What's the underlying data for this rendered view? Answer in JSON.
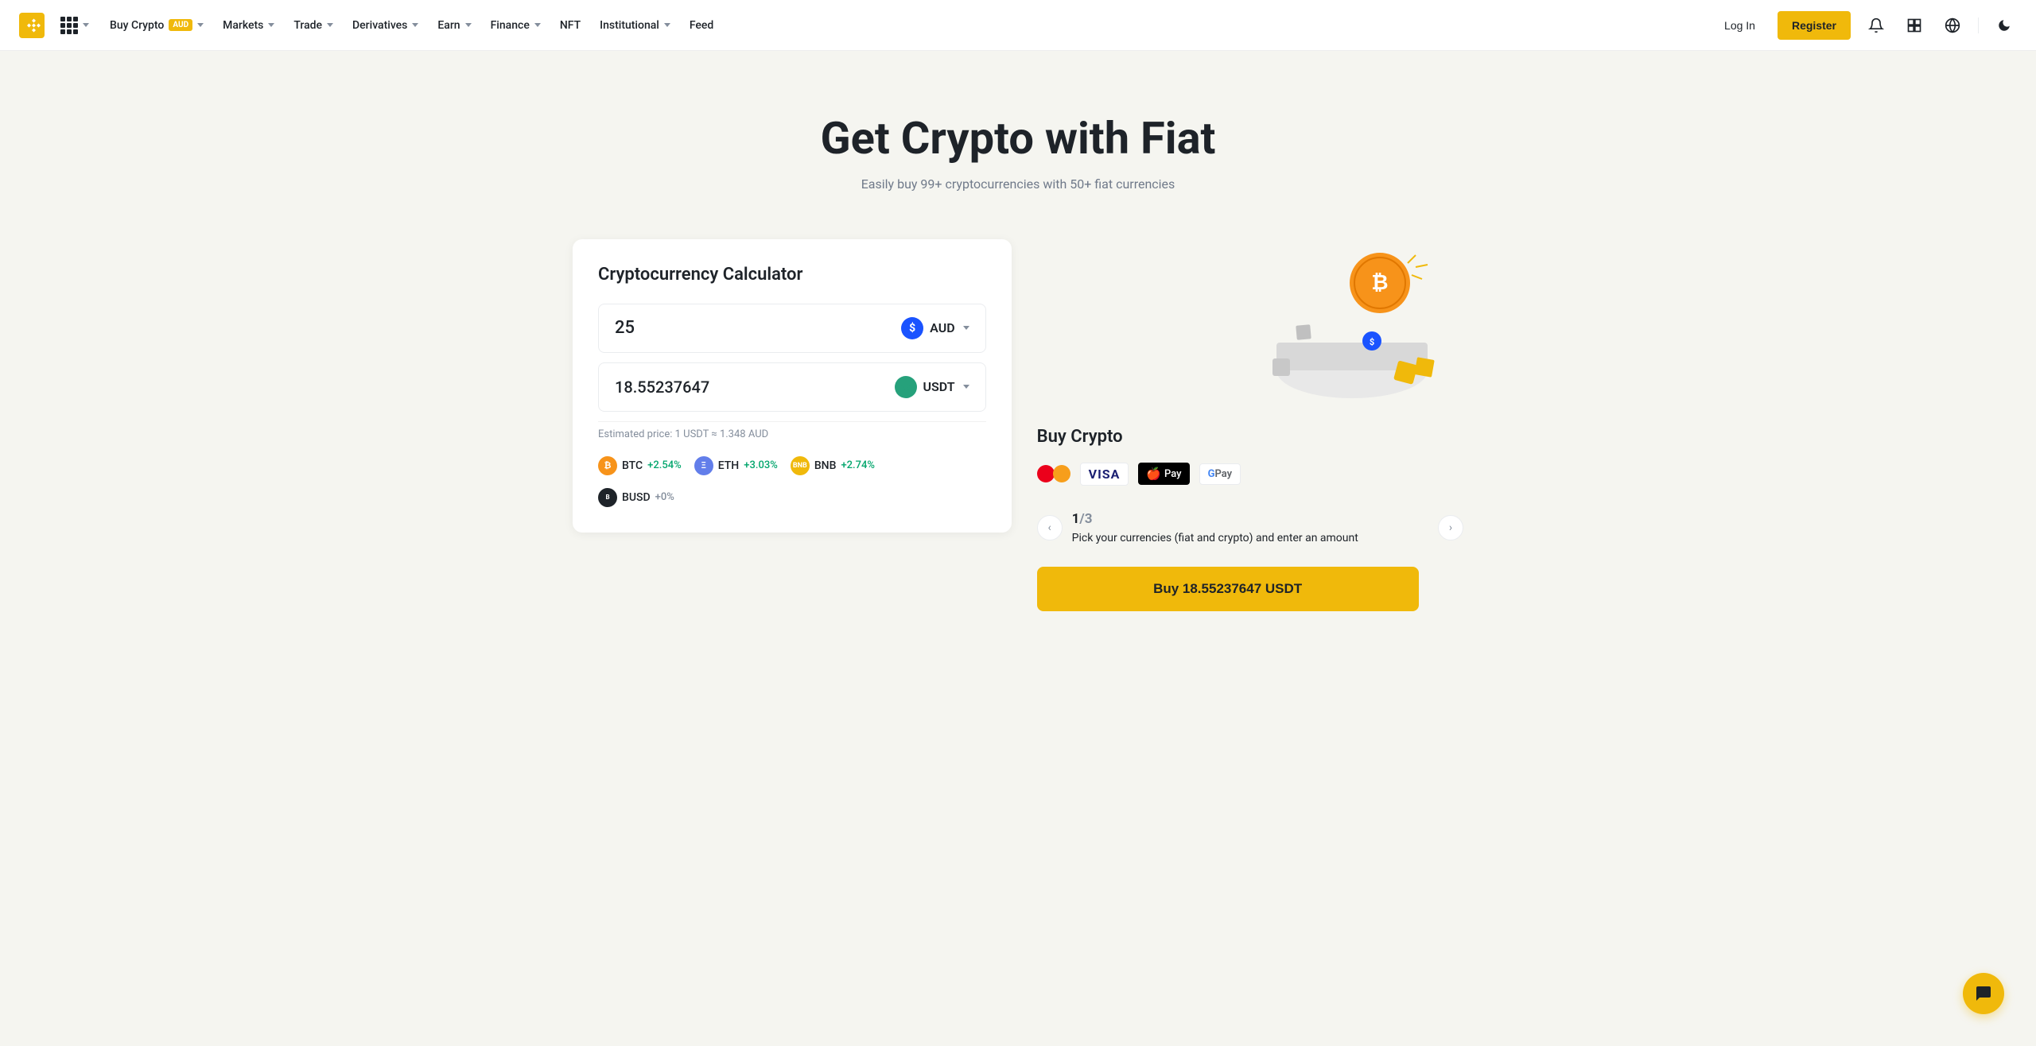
{
  "brand": {
    "name": "Binance"
  },
  "navbar": {
    "buy_crypto_label": "Buy Crypto",
    "buy_crypto_badge": "AUD",
    "markets_label": "Markets",
    "trade_label": "Trade",
    "derivatives_label": "Derivatives",
    "earn_label": "Earn",
    "finance_label": "Finance",
    "nft_label": "NFT",
    "institutional_label": "Institutional",
    "feed_label": "Feed",
    "login_label": "Log In",
    "register_label": "Register"
  },
  "hero": {
    "title": "Get Crypto with Fiat",
    "subtitle": "Easily buy 99+ cryptocurrencies with 50+ fiat currencies"
  },
  "calculator": {
    "title": "Cryptocurrency Calculator",
    "input_value": "25",
    "input_currency": "AUD",
    "output_value": "18.55237647",
    "output_currency": "USDT",
    "estimated_price": "Estimated price: 1 USDT ≈ 1.348 AUD",
    "cryptos": [
      {
        "name": "BTC",
        "change": "+2.54%",
        "positive": true
      },
      {
        "name": "ETH",
        "change": "+3.03%",
        "positive": true
      },
      {
        "name": "BNB",
        "change": "+2.74%",
        "positive": true
      },
      {
        "name": "BUSD",
        "change": "+0%",
        "positive": false
      }
    ]
  },
  "buy_panel": {
    "title": "Buy Crypto",
    "carousel": {
      "current": "1",
      "total": "3",
      "description": "Pick your currencies (fiat and crypto) and enter an amount"
    },
    "buy_button": "Buy 18.55237647 USDT",
    "payment_methods": [
      "Mastercard",
      "VISA",
      "Apple Pay",
      "Google Pay"
    ]
  },
  "chat": {
    "icon": "💬"
  }
}
